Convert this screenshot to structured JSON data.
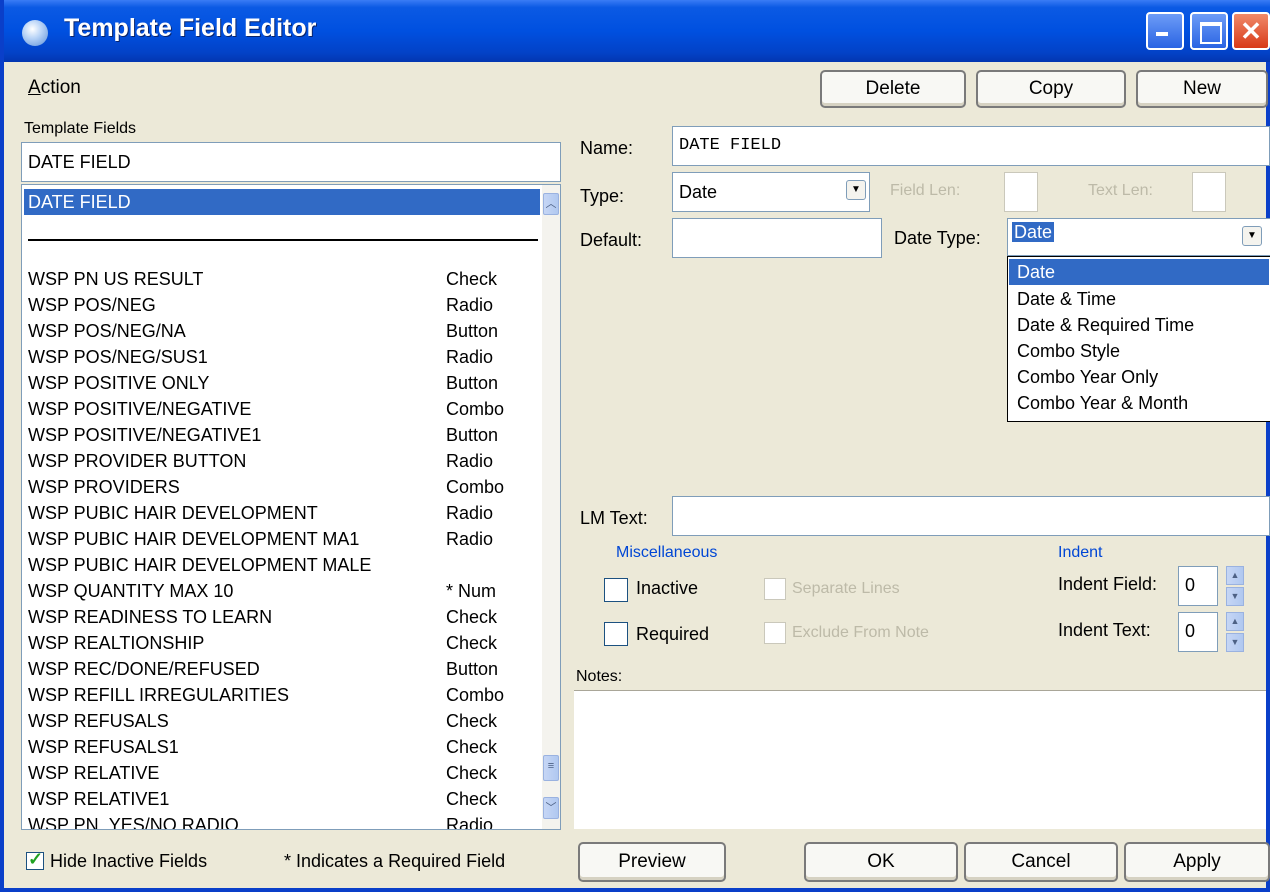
{
  "window": {
    "title": "Template Field Editor"
  },
  "menu": {
    "action": "Action"
  },
  "toolbar": {
    "delete": "Delete",
    "copy": "Copy",
    "new": "New"
  },
  "left": {
    "label": "Template Fields",
    "search_value": "DATE FIELD",
    "selected_item": "DATE FIELD",
    "items": [
      {
        "name": "WSP PN US RESULT",
        "type": "Check"
      },
      {
        "name": "WSP POS/NEG",
        "type": "Radio"
      },
      {
        "name": "WSP POS/NEG/NA",
        "type": "Button"
      },
      {
        "name": "WSP POS/NEG/SUS1",
        "type": "Radio"
      },
      {
        "name": "WSP POSITIVE ONLY",
        "type": "Button"
      },
      {
        "name": "WSP POSITIVE/NEGATIVE",
        "type": "Combo"
      },
      {
        "name": "WSP POSITIVE/NEGATIVE1",
        "type": "Button"
      },
      {
        "name": "WSP PROVIDER BUTTON",
        "type": "Radio"
      },
      {
        "name": "WSP PROVIDERS",
        "type": "Combo"
      },
      {
        "name": "WSP PUBIC HAIR DEVELOPMENT",
        "type": "Radio"
      },
      {
        "name": "WSP PUBIC HAIR DEVELOPMENT MA1",
        "type": "Radio"
      },
      {
        "name": "WSP PUBIC HAIR DEVELOPMENT MALE",
        "type": ""
      },
      {
        "name": "WSP QUANTITY MAX 10",
        "type": "* Num"
      },
      {
        "name": "WSP READINESS TO LEARN",
        "type": "Check"
      },
      {
        "name": "WSP REALTIONSHIP",
        "type": "Check"
      },
      {
        "name": "WSP REC/DONE/REFUSED",
        "type": "Button"
      },
      {
        "name": "WSP REFILL IRREGULARITIES",
        "type": "Combo"
      },
      {
        "name": "WSP REFUSALS",
        "type": "Check"
      },
      {
        "name": "WSP REFUSALS1",
        "type": "Check"
      },
      {
        "name": "WSP RELATIVE",
        "type": "Check"
      },
      {
        "name": "WSP RELATIVE1",
        "type": "Check"
      },
      {
        "name": "WSP PN_YES/NO RADIO",
        "type": "Radio"
      }
    ],
    "hide_inactive": "Hide Inactive Fields",
    "required_note": "* Indicates a Required Field"
  },
  "form": {
    "name_label": "Name:",
    "name_value": "DATE FIELD",
    "type_label": "Type:",
    "type_value": "Date",
    "field_len_label": "Field Len:",
    "text_len_label": "Text Len:",
    "default_label": "Default:",
    "date_type_label": "Date Type:",
    "date_type_value": "Date",
    "date_type_options": [
      "Date",
      "Date & Time",
      "Date & Required Time",
      "Combo Style",
      "Combo Year Only",
      "Combo Year & Month"
    ],
    "lm_text_label": "LM Text:",
    "misc_title": "Miscellaneous",
    "inactive": "Inactive",
    "required": "Required",
    "separate_lines": "Separate Lines",
    "exclude_from_note": "Exclude From Note",
    "indent_title": "Indent",
    "indent_field_label": "Indent Field:",
    "indent_field_value": "0",
    "indent_text_label": "Indent Text:",
    "indent_text_value": "0",
    "notes_label": "Notes:"
  },
  "footer": {
    "preview": "Preview",
    "ok": "OK",
    "cancel": "Cancel",
    "apply": "Apply"
  }
}
